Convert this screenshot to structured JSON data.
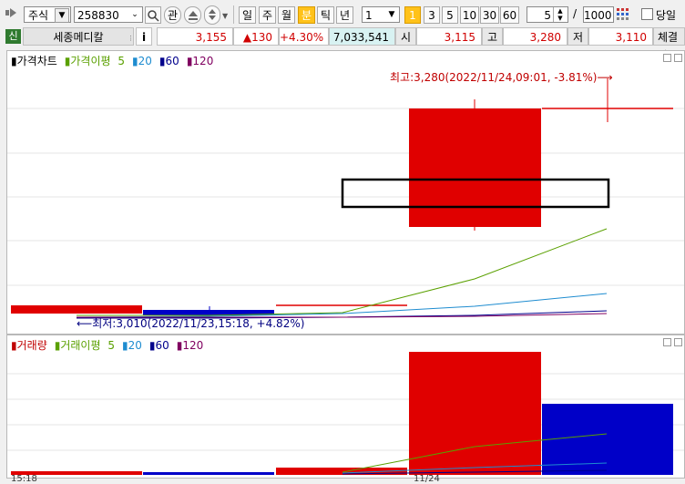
{
  "toolbar": {
    "market_type": "주식",
    "code": "258830",
    "watch_btn": "관",
    "periods": [
      "일",
      "주",
      "월",
      "분",
      "틱",
      "년"
    ],
    "active_period": "분",
    "interval_value": "1",
    "minute_presets": [
      "1",
      "3",
      "5",
      "10",
      "30",
      "60"
    ],
    "active_preset": "1",
    "scroll_value": "5",
    "separator": "/",
    "count_value": "1000",
    "today_label": "당일"
  },
  "stock": {
    "badge": "신",
    "name": "세종메디칼",
    "info_btn": "i",
    "price": "3,155",
    "change": "▲130",
    "change_pct": "+4.30%",
    "volume": "7,033,541",
    "open_label": "시",
    "open": "3,115",
    "high_label": "고",
    "high": "3,280",
    "low_label": "저",
    "low": "3,110",
    "trade_label": "체결강"
  },
  "price_chart": {
    "legend": {
      "title": "가격차트",
      "ma_title": "가격이평",
      "ma5": "5",
      "ma20": "20",
      "ma60": "60",
      "ma120": "120"
    },
    "high_annotation": "최고:3,280(2022/11/24,09:01, -3.81%)⟶",
    "low_annotation": "⟵최저:3,010(2022/11/23,15:18, +4.82%)"
  },
  "volume_chart": {
    "legend": {
      "title": "거래량",
      "ma_title": "거래이평",
      "ma5": "5",
      "ma20": "20",
      "ma60": "60",
      "ma120": "120"
    },
    "axis_left": "15:18",
    "axis_mid": "11/24"
  },
  "colors": {
    "up": "#e00000",
    "down": "#0000c8",
    "ma5": "#5aa000",
    "ma20": "#1e8cd0",
    "ma60": "#00008c",
    "ma120": "#800060"
  }
}
